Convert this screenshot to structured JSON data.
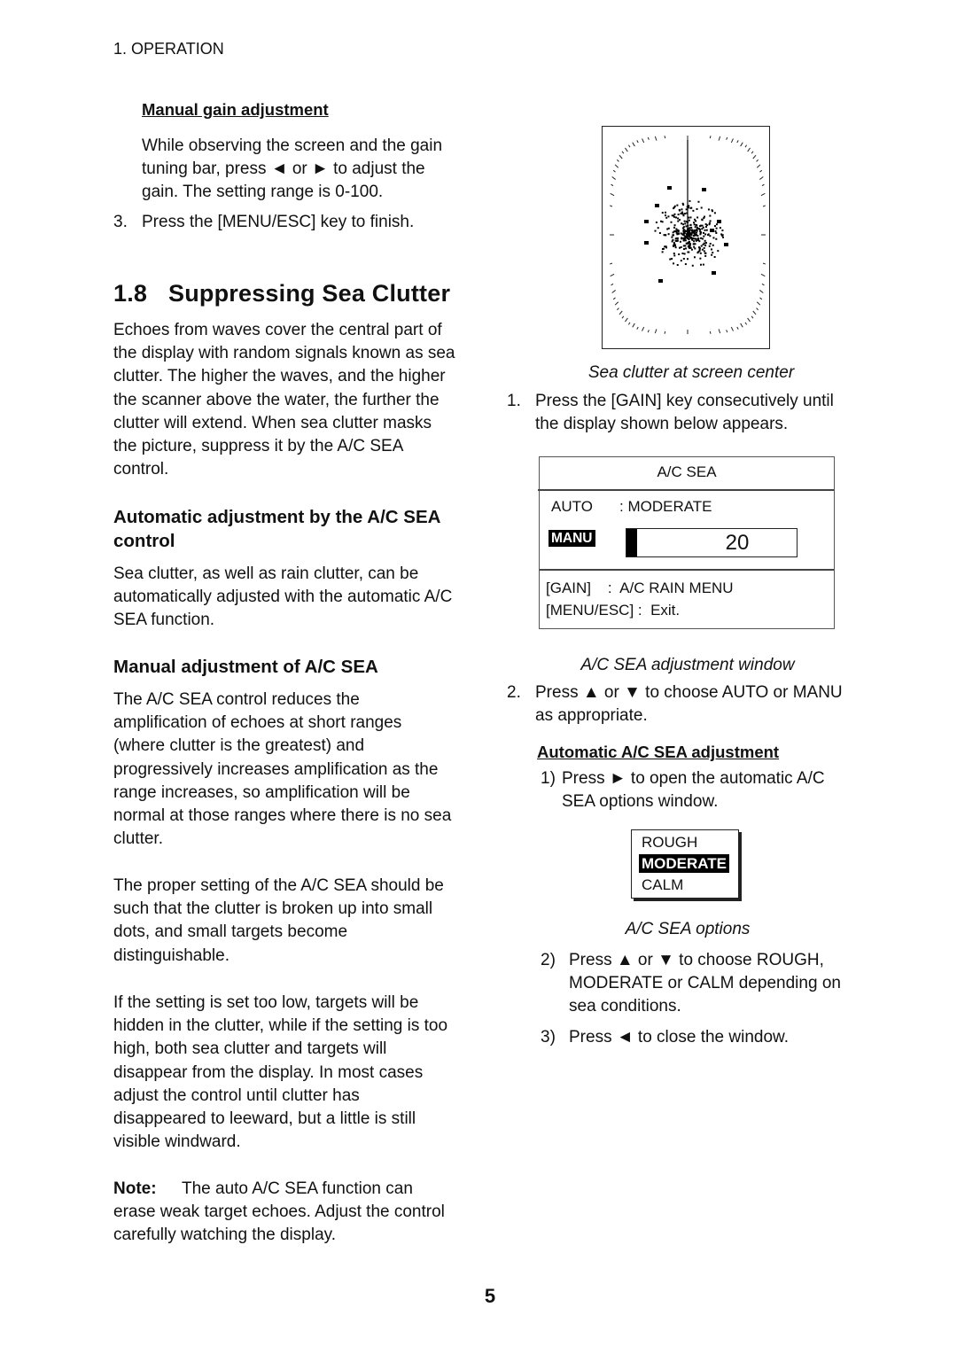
{
  "header": {
    "section_label": "1. OPERATION"
  },
  "left_column": {
    "manual_gain": {
      "heading": "Manual gain adjustment",
      "text_lines": [
        "While observing the screen and the gain",
        "tuning bar, press ◄ or ► to adjust the",
        "gain. The setting range is 0-100."
      ],
      "step3": {
        "number": "3.",
        "text": "Press the [MENU/ESC] key to finish."
      }
    },
    "section": {
      "number": "1.8",
      "title": "Suppressing Sea Clutter"
    },
    "intro_lines": [
      "Echoes from waves cover the central part of",
      "the display with random signals known as sea",
      "clutter. The higher the waves, and the higher",
      "the scanner above the water, the further the",
      "clutter will extend. When sea clutter masks",
      "the picture, suppress it by the A/C SEA",
      "control."
    ],
    "auto_heading_lines": [
      "Automatic adjustment by the A/C SEA",
      "control"
    ],
    "auto_text_lines": [
      "Sea clutter, as well as rain clutter, can be",
      "automatically adjusted with the automatic A/C",
      "SEA function."
    ],
    "manual_heading": "Manual adjustment of A/C SEA",
    "manual_p1_lines": [
      "The A/C SEA control reduces the",
      "amplification of echoes at short ranges",
      "(where clutter is the greatest) and",
      "progressively increases amplification as the",
      "range increases, so amplification will be",
      "normal at those ranges where there is no sea",
      "clutter."
    ],
    "manual_p2_lines": [
      "The proper setting of the A/C SEA should be",
      "such that the clutter is broken up into small",
      "dots, and small targets become",
      "distinguishable."
    ],
    "manual_p3_lines": [
      "If the setting is set too low, targets will be",
      "hidden in the clutter, while if the setting is too",
      "high, both sea clutter and targets will",
      "disappear from the display. In most cases",
      "adjust the control until clutter has",
      "disappeared to leeward, but a little is still",
      "visible windward."
    ],
    "note": {
      "label": "Note:",
      "lines": [
        "The auto A/C SEA function can",
        "erase weak target echoes. Adjust the control",
        "carefully watching the display."
      ]
    }
  },
  "right_column": {
    "radar_figure_caption": "Sea clutter at screen center",
    "step1": {
      "number": "1.",
      "lines": [
        "Press the [GAIN] key consecutively until",
        "the display shown below appears."
      ]
    },
    "acsea_window": {
      "title": "A/C SEA",
      "auto_label": "AUTO",
      "auto_value": ": MODERATE",
      "manu_label": "MANU",
      "manu_value": "20",
      "manu_value_fraction": 0.2,
      "key_gain": "[GAIN]    :  A/C RAIN MENU",
      "key_menu": "[MENU/ESC] :  Exit."
    },
    "acsea_window_caption": "A/C SEA adjustment window",
    "step2": {
      "number": "2.",
      "lines": [
        "Press ▲ or ▼ to choose AUTO or MANU",
        "as appropriate."
      ]
    },
    "auto_adjust_heading": "Automatic A/C SEA adjustment",
    "substep1": {
      "number": "1)",
      "lines": [
        "Press ► to open the automatic A/C",
        "SEA options window."
      ]
    },
    "options_window": {
      "options": [
        "ROUGH",
        "MODERATE",
        "CALM"
      ],
      "selected": "MODERATE"
    },
    "options_caption": "A/C SEA options",
    "substep2": {
      "number": "2)",
      "lines": [
        "Press ▲ or ▼ to choose ROUGH,",
        "MODERATE or CALM depending on",
        "sea conditions."
      ]
    },
    "substep3": {
      "number": "3)",
      "lines": [
        "Press ◄ to close the window."
      ]
    }
  },
  "footer": {
    "page_number": "5"
  }
}
